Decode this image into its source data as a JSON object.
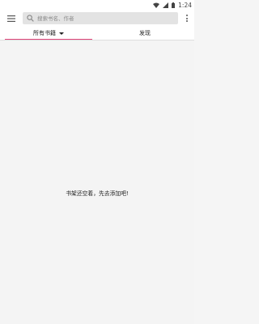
{
  "status_bar": {
    "time": "1:24",
    "icons": [
      "wifi-icon",
      "signal-icon",
      "battery-icon"
    ]
  },
  "toolbar": {
    "menu_icon": "hamburger-menu-icon",
    "search": {
      "placeholder": "搜索书名、作者",
      "value": "",
      "icon": "search-icon"
    },
    "more_icon": "more-vertical-icon"
  },
  "tabs": [
    {
      "label": "所有书籍",
      "selected": true,
      "has_dropdown": true
    },
    {
      "label": "发现",
      "selected": false,
      "has_dropdown": false
    }
  ],
  "colors": {
    "accent": "#e0447a",
    "background": "#f4f4f4",
    "surface": "#ffffff",
    "search_bg": "#e3e3e3"
  },
  "main": {
    "empty_message": "书架还空着，先去添加吧!"
  }
}
